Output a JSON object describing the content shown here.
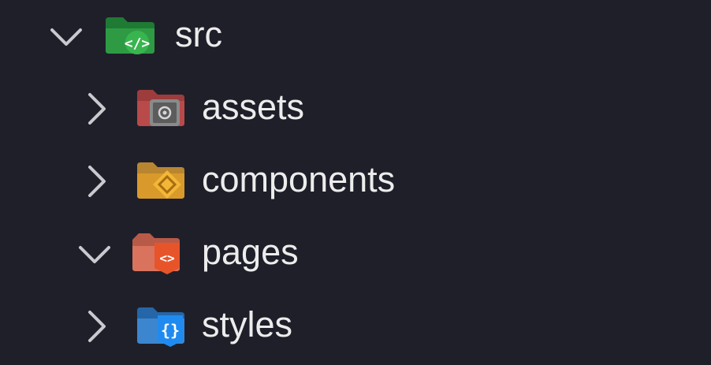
{
  "explorer": {
    "colors": {
      "background": "#1f1f2a",
      "text": "#ececec",
      "chevron": "#c9c9cf"
    },
    "items": [
      {
        "label": "src",
        "expanded": true,
        "depth": 0,
        "icon": "folder-src-icon",
        "color": "#2e9b44"
      },
      {
        "label": "assets",
        "expanded": false,
        "depth": 1,
        "icon": "folder-assets-icon",
        "color": "#b84a4a"
      },
      {
        "label": "components",
        "expanded": false,
        "depth": 1,
        "icon": "folder-components-icon",
        "color": "#d99a2b"
      },
      {
        "label": "pages",
        "expanded": true,
        "depth": 1,
        "icon": "folder-pages-icon",
        "color": "#d9583a"
      },
      {
        "label": "styles",
        "expanded": false,
        "depth": 1,
        "icon": "folder-styles-icon",
        "color": "#2b7fd4"
      }
    ]
  }
}
